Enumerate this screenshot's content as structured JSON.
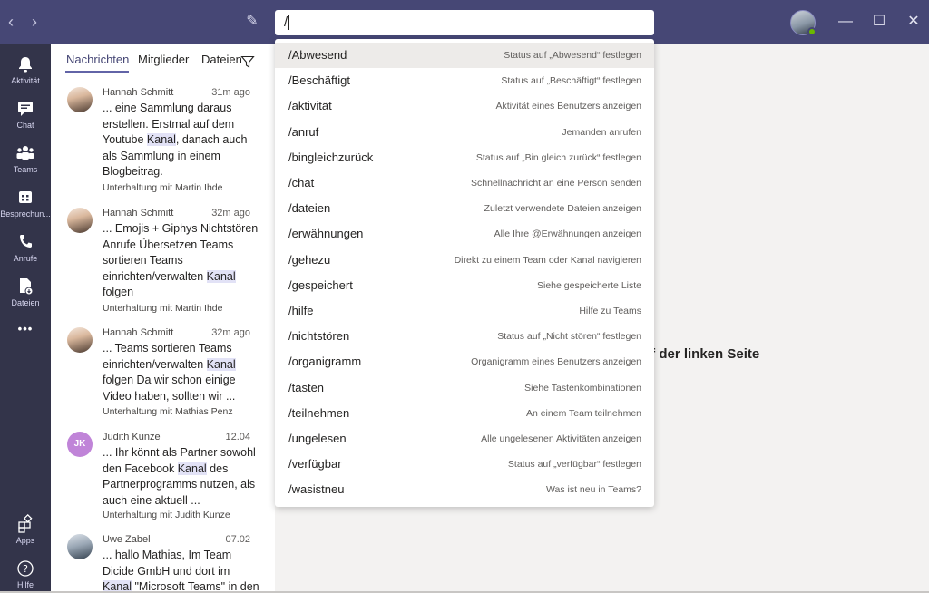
{
  "topbar": {
    "back_icon": "chevron-left-icon",
    "forward_icon": "chevron-right-icon",
    "compose_icon": "compose-icon",
    "search_value": "/",
    "win_minimize": "—",
    "win_maximize": "☐",
    "win_close": "✕",
    "back_glyph": "‹",
    "forward_glyph": "›",
    "compose_glyph": "✎"
  },
  "rail": {
    "items": [
      {
        "label": "Aktivität",
        "icon": "bell-icon"
      },
      {
        "label": "Chat",
        "icon": "chat-icon"
      },
      {
        "label": "Teams",
        "icon": "teams-icon"
      },
      {
        "label": "Besprechun...",
        "icon": "calendar-icon"
      },
      {
        "label": "Anrufe",
        "icon": "phone-icon"
      },
      {
        "label": "Dateien",
        "icon": "files-icon"
      },
      {
        "label": "Apps",
        "icon": "apps-icon"
      },
      {
        "label": "Hilfe",
        "icon": "help-icon"
      }
    ],
    "more": "•••"
  },
  "panel": {
    "tabs": [
      "Nachrichten",
      "Mitglieder",
      "Dateien"
    ],
    "messages": [
      {
        "name": "Hannah Schmitt",
        "time": "31m ago",
        "before": "... eine Sammlung daraus erstellen. Erstmal auf dem Youtube ",
        "highlight": "Kanal",
        "after": ", danach auch als Sammlung in einem Blogbeitrag.",
        "conversation": "Unterhaltung mit Martin Ihde"
      },
      {
        "name": "Hannah Schmitt",
        "time": "32m ago",
        "before": "... Emojis + Giphys Nichtstören Anrufe Übersetzen Teams sortieren Teams einrichten/verwalten ",
        "highlight": "Kanal",
        "after": " folgen",
        "conversation": "Unterhaltung mit Martin Ihde"
      },
      {
        "name": "Hannah Schmitt",
        "time": "32m ago",
        "before": "... Teams sortieren Teams einrichten/verwalten ",
        "highlight": "Kanal",
        "after": " folgen Da wir schon einige Video haben, sollten wir ...",
        "conversation": "Unterhaltung mit Mathias Penz"
      },
      {
        "name": "Judith Kunze",
        "initials": "JK",
        "time": "12.04",
        "before": "... Ihr könnt als Partner sowohl den Facebook ",
        "highlight": "Kanal",
        "after": " des Partnerprogramms nutzen, als auch eine aktuell ...",
        "conversation": "Unterhaltung mit Judith Kunze"
      },
      {
        "name": "Uwe Zabel",
        "time": "07.02",
        "before": "... hallo Mathias, Im Team Dicide GmbH und dort im ",
        "highlight": "Kanal",
        "after": " \"Microsoft Teams\" in den",
        "conversation": ""
      }
    ]
  },
  "main": {
    "hint": "uf der linken Seite"
  },
  "commands": [
    {
      "name": "/Abwesend",
      "desc": "Status auf „Abwesend“ festlegen"
    },
    {
      "name": "/Beschäftigt",
      "desc": "Status auf „Beschäftigt“ festlegen"
    },
    {
      "name": "/aktivität",
      "desc": "Aktivität eines Benutzers anzeigen"
    },
    {
      "name": "/anruf",
      "desc": "Jemanden anrufen"
    },
    {
      "name": "/bingleichzurück",
      "desc": "Status auf „Bin gleich zurück“ festlegen"
    },
    {
      "name": "/chat",
      "desc": "Schnellnachricht an eine Person senden"
    },
    {
      "name": "/dateien",
      "desc": "Zuletzt verwendete Dateien anzeigen"
    },
    {
      "name": "/erwähnungen",
      "desc": "Alle Ihre @Erwähnungen anzeigen"
    },
    {
      "name": "/gehezu",
      "desc": "Direkt zu einem Team oder Kanal navigieren"
    },
    {
      "name": "/gespeichert",
      "desc": "Siehe gespeicherte Liste"
    },
    {
      "name": "/hilfe",
      "desc": "Hilfe zu Teams"
    },
    {
      "name": "/nichtstören",
      "desc": "Status auf „Nicht stören“ festlegen"
    },
    {
      "name": "/organigramm",
      "desc": "Organigramm eines Benutzers anzeigen"
    },
    {
      "name": "/tasten",
      "desc": "Siehe Tastenkombinationen"
    },
    {
      "name": "/teilnehmen",
      "desc": "An einem Team teilnehmen"
    },
    {
      "name": "/ungelesen",
      "desc": "Alle ungelesenen Aktivitäten anzeigen"
    },
    {
      "name": "/verfügbar",
      "desc": "Status auf „verfügbar“ festlegen"
    },
    {
      "name": "/wasistneu",
      "desc": "Was ist neu in Teams?"
    }
  ],
  "selected_command_index": 0,
  "colors": {
    "header": "#464775",
    "rail": "#33344a",
    "accent": "#6264a7",
    "highlight": "#e2e2f6",
    "presence": "#6bb700"
  }
}
